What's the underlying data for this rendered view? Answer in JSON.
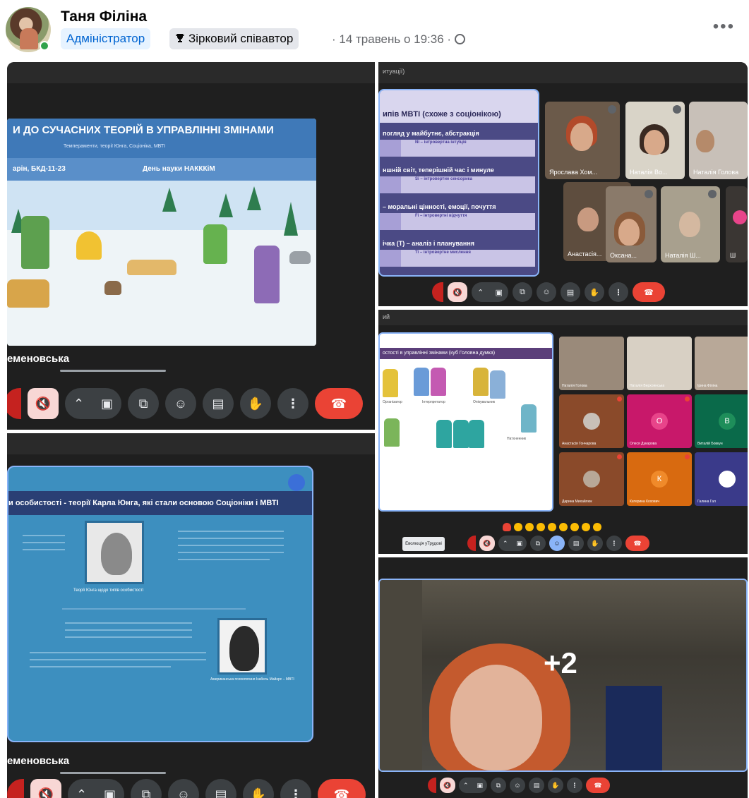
{
  "post": {
    "author": "Таня Філіна",
    "badge_admin": "Адміністратор",
    "badge_star": "Зірковий співавтор",
    "meta": "· 14 травень о 19:36 ·",
    "more": "•••"
  },
  "tile_a": {
    "slide_title": "И ДО СУЧАСНИХ ТЕОРІЙ В УПРАВЛІННІ ЗМІНАМИ",
    "slide_subtitle": "Темпераменти, теорії Юнга, Соціоніка, МВТІ",
    "info_left": "арін, БКД-11-23",
    "info_right": "День науки НАКККіМ",
    "speaker": "еменовська"
  },
  "tile_b": {
    "topbar": "итуації)",
    "slide_header": "ипів MBTI (схоже з соціонікою)",
    "rows": [
      "погляд у майбутнє, абстракція",
      "ншній світ, теперішній час і минуле",
      "– моральні цінності, емоції, почуття",
      "ічка (Т) – аналіз і планування"
    ],
    "subrows": [
      "Ni – інтровертна інтуїція",
      "Si – інтровертне сенсорика",
      "Fi – інтровертні відчуття",
      "Ti – інтровертне мислення"
    ],
    "participants": [
      "Ярослава Хом...",
      "Наталія Во...",
      "Наталія Голова",
      "Анастасія...",
      "Оксана...",
      "Наталія Ш...",
      "Ш"
    ]
  },
  "tile_c": {
    "topbar": "ий",
    "slide_header": "остості в управлінні змінами (куб Головна думка)",
    "captions": [
      "Організатор",
      "Інтерпретатор",
      "Опікувальник",
      "Натхненник"
    ],
    "participants": [
      "Наталія Голова",
      "Наталія Верхоянська",
      "Ірина Філіна",
      "Анастасія Гончарова",
      "Олеся Дукарова",
      "Виталій Бовкун",
      "Дарина Михайлюк",
      "Катерина Кохович",
      "Галина Гал"
    ],
    "letters": [
      "О",
      "В",
      "К"
    ],
    "caption_button": "Еволюція уТрудові"
  },
  "tile_d": {
    "slide_header": "и особистості - теорії Карла Юнга, які стали основою Соціоніки і МВТІ",
    "photo1_caption": "Теорії Юнга щодо типів особистості",
    "photo2_caption": "Американська психологиня Ізабель Майєрс – MBTI",
    "speaker": "еменовська"
  },
  "tile_e": {
    "extra_count": "+2"
  },
  "colors": {
    "meet_bg": "#1f1f1f",
    "end_call": "#ea4335",
    "mic_muted_bg": "#f8d7d5",
    "badge_admin_text": "#0064d1",
    "presenter_border": "#8ab4f8"
  }
}
